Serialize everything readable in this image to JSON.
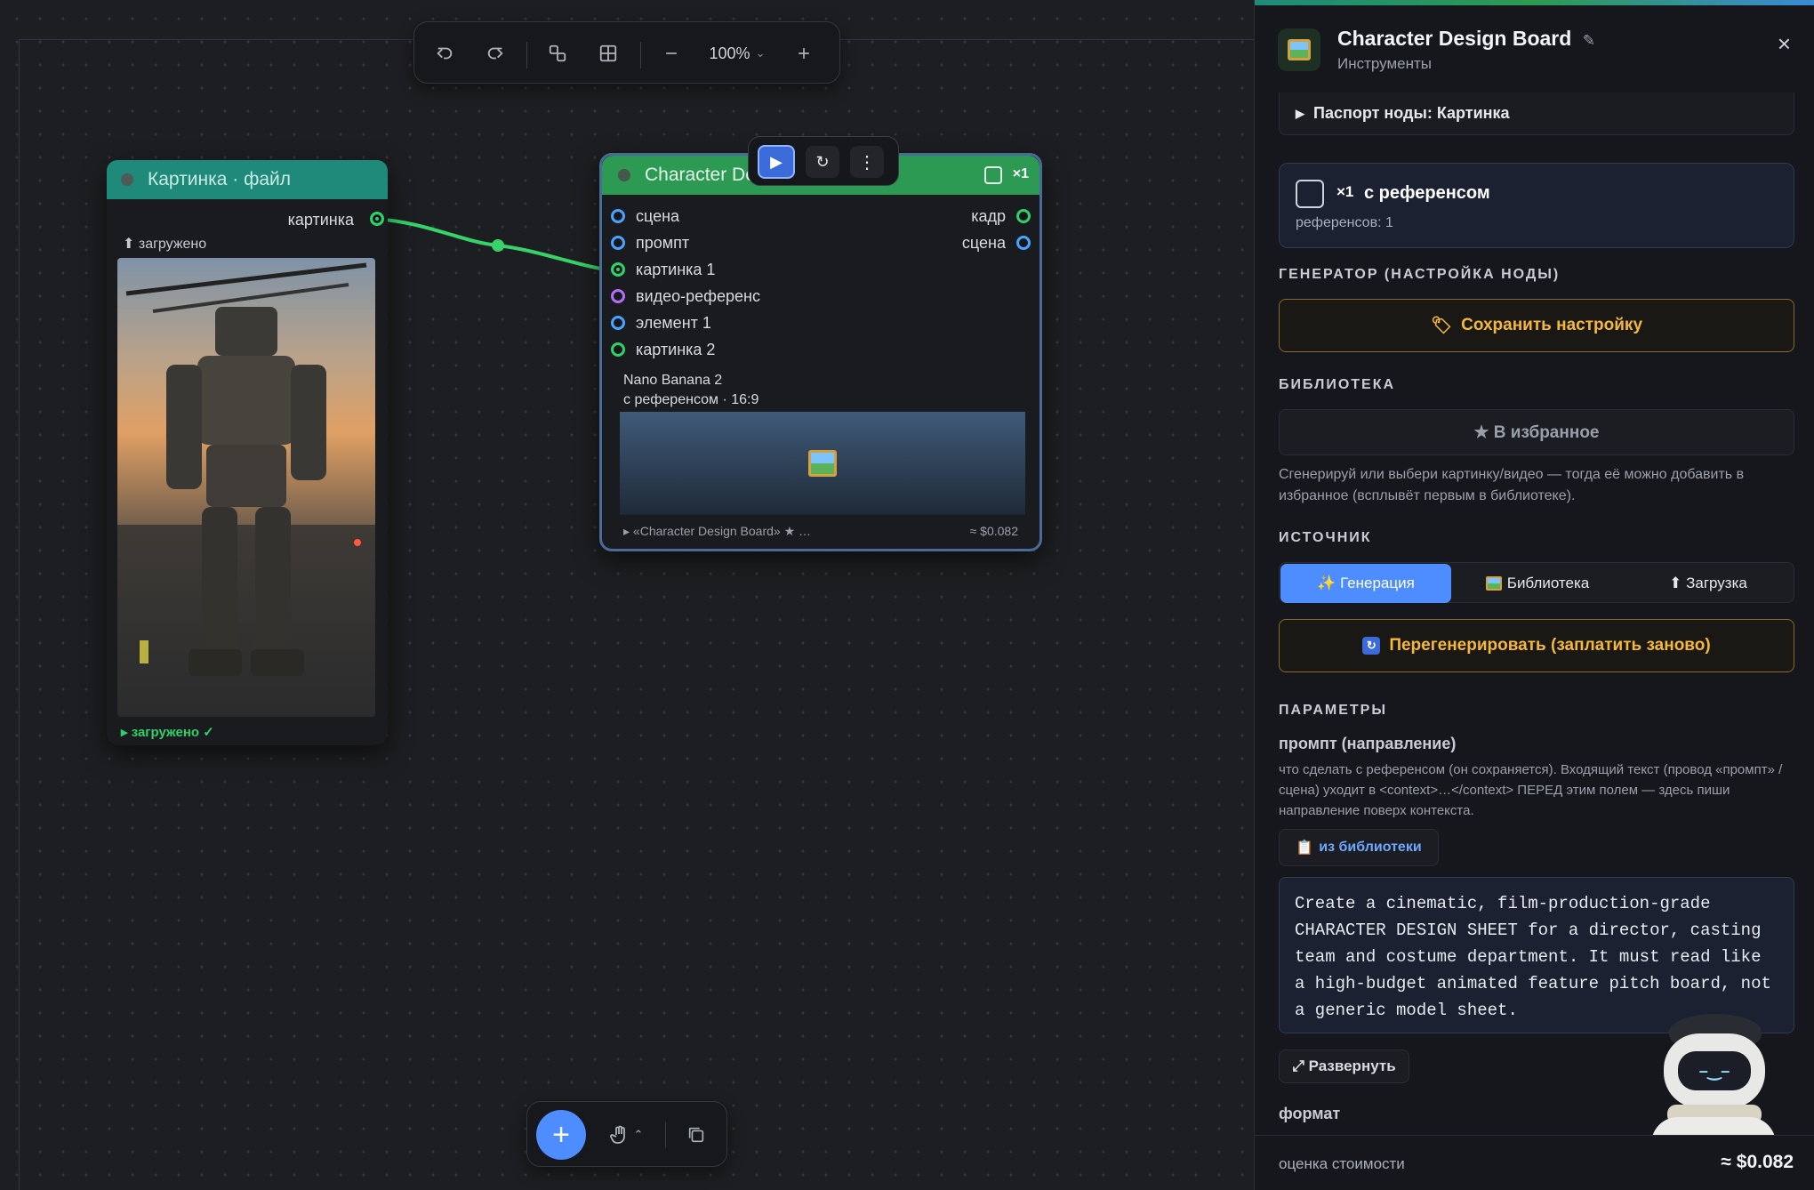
{
  "toolbar": {
    "zoom": "100%",
    "undo_icon": "undo-icon",
    "redo_icon": "redo-icon",
    "connect_icon": "shapes-icon",
    "grid_icon": "grid-icon",
    "zoom_out_icon": "minus-icon",
    "zoom_in_icon": "plus-icon",
    "zoom_chevron": "⌄"
  },
  "node_file": {
    "title": "Картинка · файл",
    "out_port": "картинка",
    "status_top": "загружено",
    "status_bottom": "загружено ✓",
    "accent": "#1f8a7a"
  },
  "node_board": {
    "title": "Character Design Board",
    "badge": "×1",
    "inputs": [
      "сцена",
      "промпт",
      "картинка 1",
      "видео-референс",
      "элемент 1",
      "картинка 2"
    ],
    "outputs": [
      "кадр",
      "сцена"
    ],
    "model": "Nano Banana 2",
    "mode": "с референсом · 16:9",
    "footer": "▸ «Character Design Board» ★ …",
    "price": "≈ $0.082",
    "accent": "#2c9a52"
  },
  "bottombar": {
    "add_icon": "+",
    "hand_icon": "hand-icon",
    "chevron": "⌃"
  },
  "panel": {
    "title": "Character Design Board",
    "edit_icon": "✎",
    "subtitle": "Инструменты",
    "close": "×",
    "passport": "Паспорт ноды: Картинка",
    "ref": {
      "badge": "×1",
      "label": "с референсом",
      "count": "референсов: 1"
    },
    "generator": {
      "heading": "ГЕНЕРАТОР (НАСТРОЙКА НОДЫ)",
      "save": "Сохранить настройку"
    },
    "library": {
      "heading": "БИБЛИОТЕКА",
      "fav": "★ В избранное",
      "hint": "Сгенерируй или выбери картинку/видео — тогда её можно добавить в избранное (всплывёт первым в библиотеке)."
    },
    "source": {
      "heading": "ИСТОЧНИК",
      "tabs": [
        "✨ Генерация",
        "Библиотека",
        "⬆ Загрузка"
      ],
      "regen": "Перегенерировать (заплатить заново)"
    },
    "params": {
      "heading": "ПАРАМЕТРЫ",
      "prompt_label": "промпт (направление)",
      "prompt_hint": "что сделать с референсом (он сохраняется). Входящий текст (провод «промпт» / сцена) уходит в <context>…</context> ПЕРЕД этим полем — здесь пиши направление поверх контекста.",
      "from_lib": "из библиотеки",
      "prompt_value": "Create a cinematic, film-production-grade CHARACTER DESIGN SHEET for a director, casting team and costume department. It must read like a high-budget animated feature pitch board, not a generic model sheet.",
      "expand": "⤢ Развернуть",
      "format_label": "формат"
    },
    "footer": {
      "label": "оценка стоимости",
      "value": "≈ $0.082"
    }
  },
  "colors": {
    "accent_blue": "#4d8dff",
    "gold": "#f5b83a",
    "green": "#2fd16a"
  }
}
